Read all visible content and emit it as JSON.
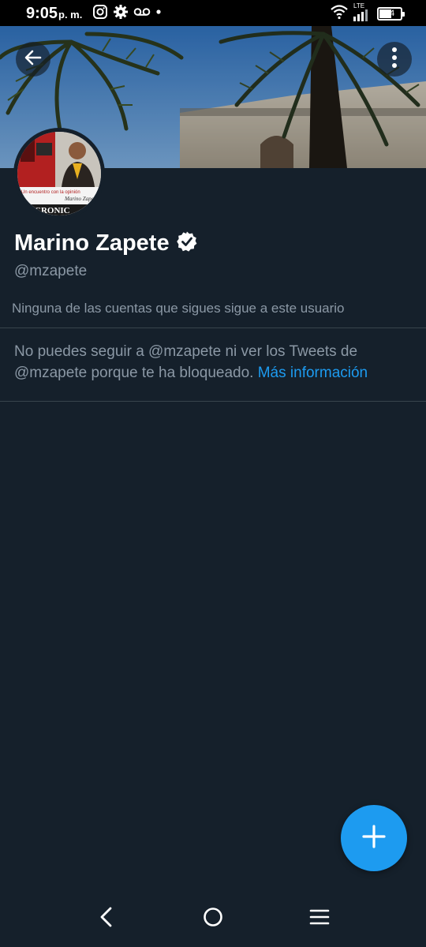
{
  "status_bar": {
    "time": "9:05",
    "ampm": "p. m.",
    "network": "LTE",
    "battery": "54",
    "icons_left": [
      "instagram-icon",
      "settings-gear-icon",
      "voicemail-icon",
      "notification-dot-icon"
    ],
    "icons_right": [
      "wifi-icon",
      "signal-icon",
      "battery-icon"
    ]
  },
  "profile": {
    "name": "Marino Zapete",
    "verified": true,
    "handle": "@mzapete",
    "follow_context": "Ninguna de las cuentas que sigues sigue a este usuario"
  },
  "blocked_notice": {
    "message": "No puedes seguir a @mzapete ni ver los Tweets de @mzapete porque te ha bloqueado.",
    "link_text": "Más información"
  },
  "avatar_text": {
    "line1": "Un encuentro con la opinión",
    "line2": "Marino Zapete",
    "line3": "CRONIC"
  },
  "colors": {
    "background": "#15202b",
    "accent": "#1d9bf0",
    "secondary_text": "#8b98a5",
    "divider": "#38444d"
  }
}
